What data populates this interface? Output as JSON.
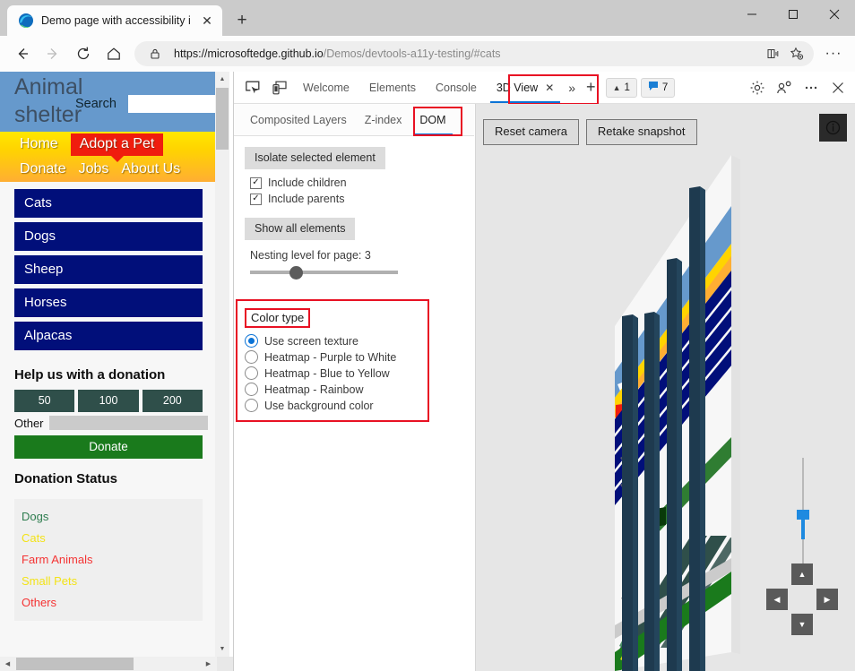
{
  "browser": {
    "tab": {
      "title": "Demo page with accessibility iss",
      "favicon": "edge-logo-icon",
      "close": "✕"
    },
    "new_tab_label": "+",
    "window_controls": {
      "minimize": "—",
      "maximize": "☐",
      "close": "✕"
    },
    "nav": {
      "back": "←",
      "forward": "→",
      "reload": "↻",
      "home": "⌂"
    },
    "address": {
      "lock_icon": "lock-icon",
      "scheme_and_host": "https://microsoftedge.github.io",
      "path": "/Demos/devtools-a11y-testing/#cats",
      "full_url": "https://microsoftedge.github.io/Demos/devtools-a11y-testing/#cats",
      "read_aloud_icon": "read-aloud-icon",
      "favorite_icon": "add-favorite-icon"
    },
    "settings_dots": "···"
  },
  "page": {
    "title": "Animal shelter",
    "search_label": "Search",
    "search_value": "",
    "nav_primary": [
      "Home",
      "Adopt a Pet"
    ],
    "nav_secondary": [
      "Donate",
      "Jobs",
      "About Us"
    ],
    "active_nav": "Adopt a Pet",
    "categories": [
      "Cats",
      "Dogs",
      "Sheep",
      "Horses",
      "Alpacas"
    ],
    "donation": {
      "heading": "Help us with a donation",
      "amounts": [
        "50",
        "100",
        "200"
      ],
      "other_label": "Other",
      "other_value": "",
      "donate_button": "Donate"
    },
    "status": {
      "heading": "Donation Status",
      "items": [
        {
          "label": "Dogs",
          "color": "#2e7d4f"
        },
        {
          "label": "Cats",
          "color": "#f3e318"
        },
        {
          "label": "Farm Animals",
          "color": "#f43434"
        },
        {
          "label": "Small Pets",
          "color": "#f3e318"
        },
        {
          "label": "Others",
          "color": "#f43434"
        }
      ]
    },
    "colors": {
      "header_bg": "#6699cc",
      "nav_bg": "#ffd400",
      "nav_active_bg": "#f01d0e",
      "category_bg": "#010f7a",
      "amount_bg": "#2f4f4a",
      "donate_bg": "#1a7a1c"
    }
  },
  "devtools": {
    "left_icons": [
      "inspect-element-icon",
      "device-emulation-icon"
    ],
    "tabs": [
      {
        "label": "Welcome",
        "active": false
      },
      {
        "label": "Elements",
        "active": false
      },
      {
        "label": "Console",
        "active": false
      },
      {
        "label": "3D View",
        "active": true,
        "closable": true,
        "close": "✕"
      }
    ],
    "more_tabs": "»",
    "add_tab": "+",
    "badges": [
      {
        "icon": "warning-triangle-icon",
        "glyph": "▲",
        "count": "1",
        "color": "#3b3b3b"
      },
      {
        "icon": "message-bubble-icon",
        "glyph": "●",
        "count": "7",
        "color": "#1b7fd4"
      }
    ],
    "right_icons": [
      "settings-gear-icon",
      "customize-icon",
      "more-options-icon",
      "close-devtools-icon"
    ],
    "subtabs": [
      {
        "label": "Composited Layers",
        "active": false
      },
      {
        "label": "Z-index",
        "active": false
      },
      {
        "label": "DOM",
        "active": true
      }
    ],
    "panel": {
      "isolate_button": "Isolate selected element",
      "checkboxes": [
        {
          "label": "Include children",
          "checked": true
        },
        {
          "label": "Include parents",
          "checked": true
        }
      ],
      "show_all_button": "Show all elements",
      "nesting_label": "Nesting level for page: 3",
      "nesting_value": 3,
      "color_type": {
        "legend": "Color type",
        "options": [
          {
            "label": "Use screen texture",
            "selected": true
          },
          {
            "label": "Heatmap - Purple to White",
            "selected": false
          },
          {
            "label": "Heatmap - Blue to Yellow",
            "selected": false
          },
          {
            "label": "Heatmap - Rainbow",
            "selected": false
          },
          {
            "label": "Use background color",
            "selected": false
          }
        ]
      }
    },
    "view3d": {
      "reset_camera": "Reset camera",
      "retake_snapshot": "Retake snapshot",
      "info_icon": "info-icon",
      "zoom_slider_label": "zoom-slider",
      "dpad": {
        "up": "▲",
        "down": "▼",
        "left": "◀",
        "right": "▶"
      }
    },
    "highlight_color": "#e81123"
  }
}
